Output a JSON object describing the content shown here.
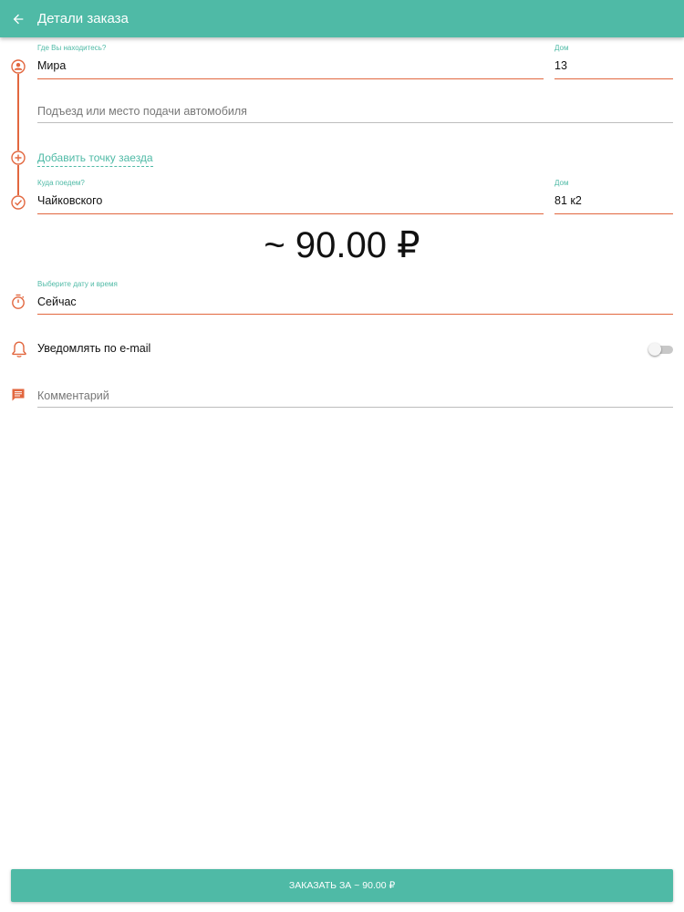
{
  "header": {
    "title": "Детали заказа",
    "back_icon": "arrow-left-icon"
  },
  "route": {
    "from": {
      "label": "Где Вы находитесь?",
      "value": "Мира"
    },
    "from_house": {
      "label": "Дом",
      "value": "13"
    },
    "entrance": {
      "placeholder": "Подъезд или место подачи автомобиля"
    },
    "add_stop_label": "Добавить точку заезда",
    "to": {
      "label": "Куда поедем?",
      "value": "Чайковского"
    },
    "to_house": {
      "label": "Дом",
      "value": "81 к2"
    }
  },
  "price": "~ 90.00 ₽",
  "datetime": {
    "label": "Выберите дату и время",
    "value": "Сейчас"
  },
  "notify": {
    "label": "Уведомлять по e-mail",
    "enabled": false
  },
  "comment": {
    "placeholder": "Комментарий"
  },
  "order_button": {
    "label": "ЗАКАЗАТЬ ЗА ~ 90.00 ₽"
  },
  "colors": {
    "primary": "#4fbaa6",
    "accent": "#e2673f"
  }
}
